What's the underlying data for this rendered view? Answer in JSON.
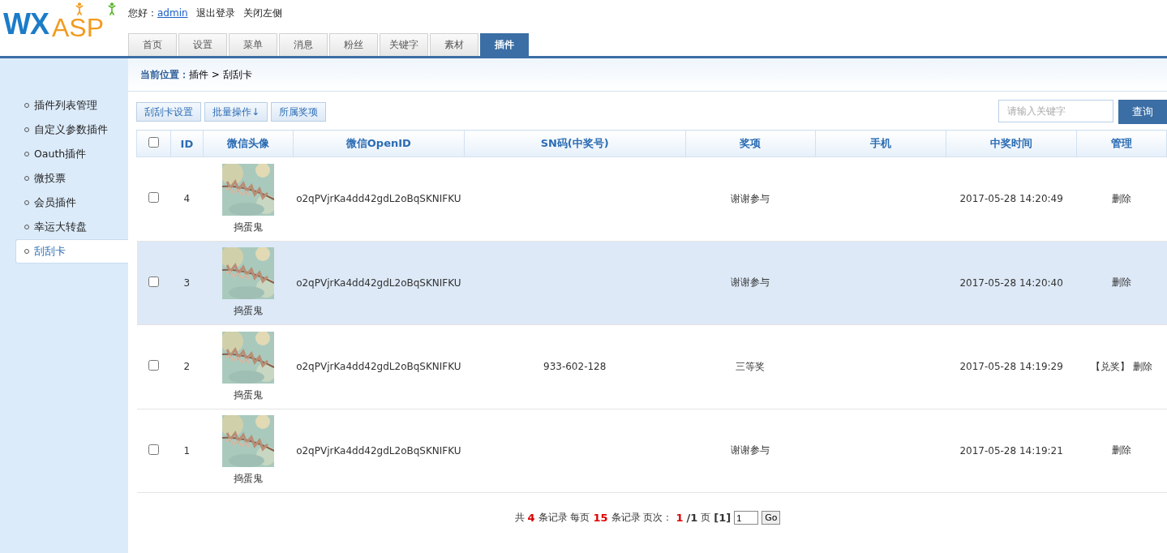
{
  "logo": {
    "part_1": "WX",
    "part_2": "ASP"
  },
  "header": {
    "greeting": "您好：",
    "user": "admin",
    "links": [
      "退出登录",
      "关闭左侧"
    ]
  },
  "tabs": [
    {
      "label": "首页",
      "selected": false
    },
    {
      "label": "设置",
      "selected": false
    },
    {
      "label": "菜单",
      "selected": false
    },
    {
      "label": "消息",
      "selected": false
    },
    {
      "label": "粉丝",
      "selected": false
    },
    {
      "label": "关键字",
      "selected": false
    },
    {
      "label": "素材",
      "selected": false
    },
    {
      "label": "插件",
      "selected": true
    }
  ],
  "sidebar": {
    "items": [
      {
        "label": "插件列表管理",
        "selected": false
      },
      {
        "label": "自定义参数插件",
        "selected": false
      },
      {
        "label": "Oauth插件",
        "selected": false
      },
      {
        "label": "微投票",
        "selected": false
      },
      {
        "label": "会员插件",
        "selected": false
      },
      {
        "label": "幸运大转盘",
        "selected": false
      },
      {
        "label": "刮刮卡",
        "selected": true
      }
    ]
  },
  "breadcrumb": {
    "label": "当前位置：",
    "path": "插件 > 刮刮卡"
  },
  "toolbar": {
    "buttons": [
      "刮刮卡设置",
      "批量操作↓",
      "所属奖项"
    ],
    "search": {
      "placeholder": "请输入关键字"
    },
    "search_button": "查询"
  },
  "table": {
    "select_all": {
      "checked": false
    },
    "columns": [
      "ID",
      "微信头像",
      "微信OpenID",
      "SN码(中奖号)",
      "奖项",
      "手机",
      "中奖时间",
      "管理"
    ],
    "rows": [
      {
        "checked": false,
        "highlighted": false,
        "id": "4",
        "avatar": {
          "kind": "picture",
          "name": "捣蛋鬼"
        },
        "openid": "o2qPVjrKa4dd42gdL2oBqSKNIFKU",
        "sn": "",
        "prize": "谢谢参与",
        "phone": "",
        "time": "2017-05-28 14:20:49",
        "actions": [
          "删除"
        ]
      },
      {
        "checked": false,
        "highlighted": true,
        "id": "3",
        "avatar": {
          "kind": "picture",
          "name": "捣蛋鬼"
        },
        "openid": "o2qPVjrKa4dd42gdL2oBqSKNIFKU",
        "sn": "",
        "prize": "谢谢参与",
        "phone": "",
        "time": "2017-05-28 14:20:40",
        "actions": [
          "删除"
        ]
      },
      {
        "checked": false,
        "highlighted": false,
        "id": "2",
        "avatar": {
          "kind": "picture",
          "name": "捣蛋鬼"
        },
        "openid": "o2qPVjrKa4dd42gdL2oBqSKNIFKU",
        "sn": "933-602-128",
        "prize": "三等奖",
        "phone": "",
        "time": "2017-05-28 14:19:29",
        "actions": [
          "【兑奖】",
          "删除"
        ]
      },
      {
        "checked": false,
        "highlighted": false,
        "id": "1",
        "avatar": {
          "kind": "picture",
          "name": "捣蛋鬼"
        },
        "openid": "o2qPVjrKa4dd42gdL2oBqSKNIFKU",
        "sn": "",
        "prize": "谢谢参与",
        "phone": "",
        "time": "2017-05-28 14:19:21",
        "actions": [
          "删除"
        ]
      }
    ]
  },
  "pagination": {
    "segments": [
      {
        "kind": "plain",
        "text": "共"
      },
      {
        "kind": "red",
        "text": "4"
      },
      {
        "kind": "plain",
        "text": "条记录 每页"
      },
      {
        "kind": "red",
        "text": "15"
      },
      {
        "kind": "plain",
        "text": "条记录 页次："
      },
      {
        "kind": "red",
        "text": "1"
      },
      {
        "kind": "bold",
        "text": "/1"
      },
      {
        "kind": "plain",
        "text": "页"
      },
      {
        "kind": "bold",
        "text": "[1]"
      }
    ],
    "page_input": "1",
    "go": "Go"
  }
}
